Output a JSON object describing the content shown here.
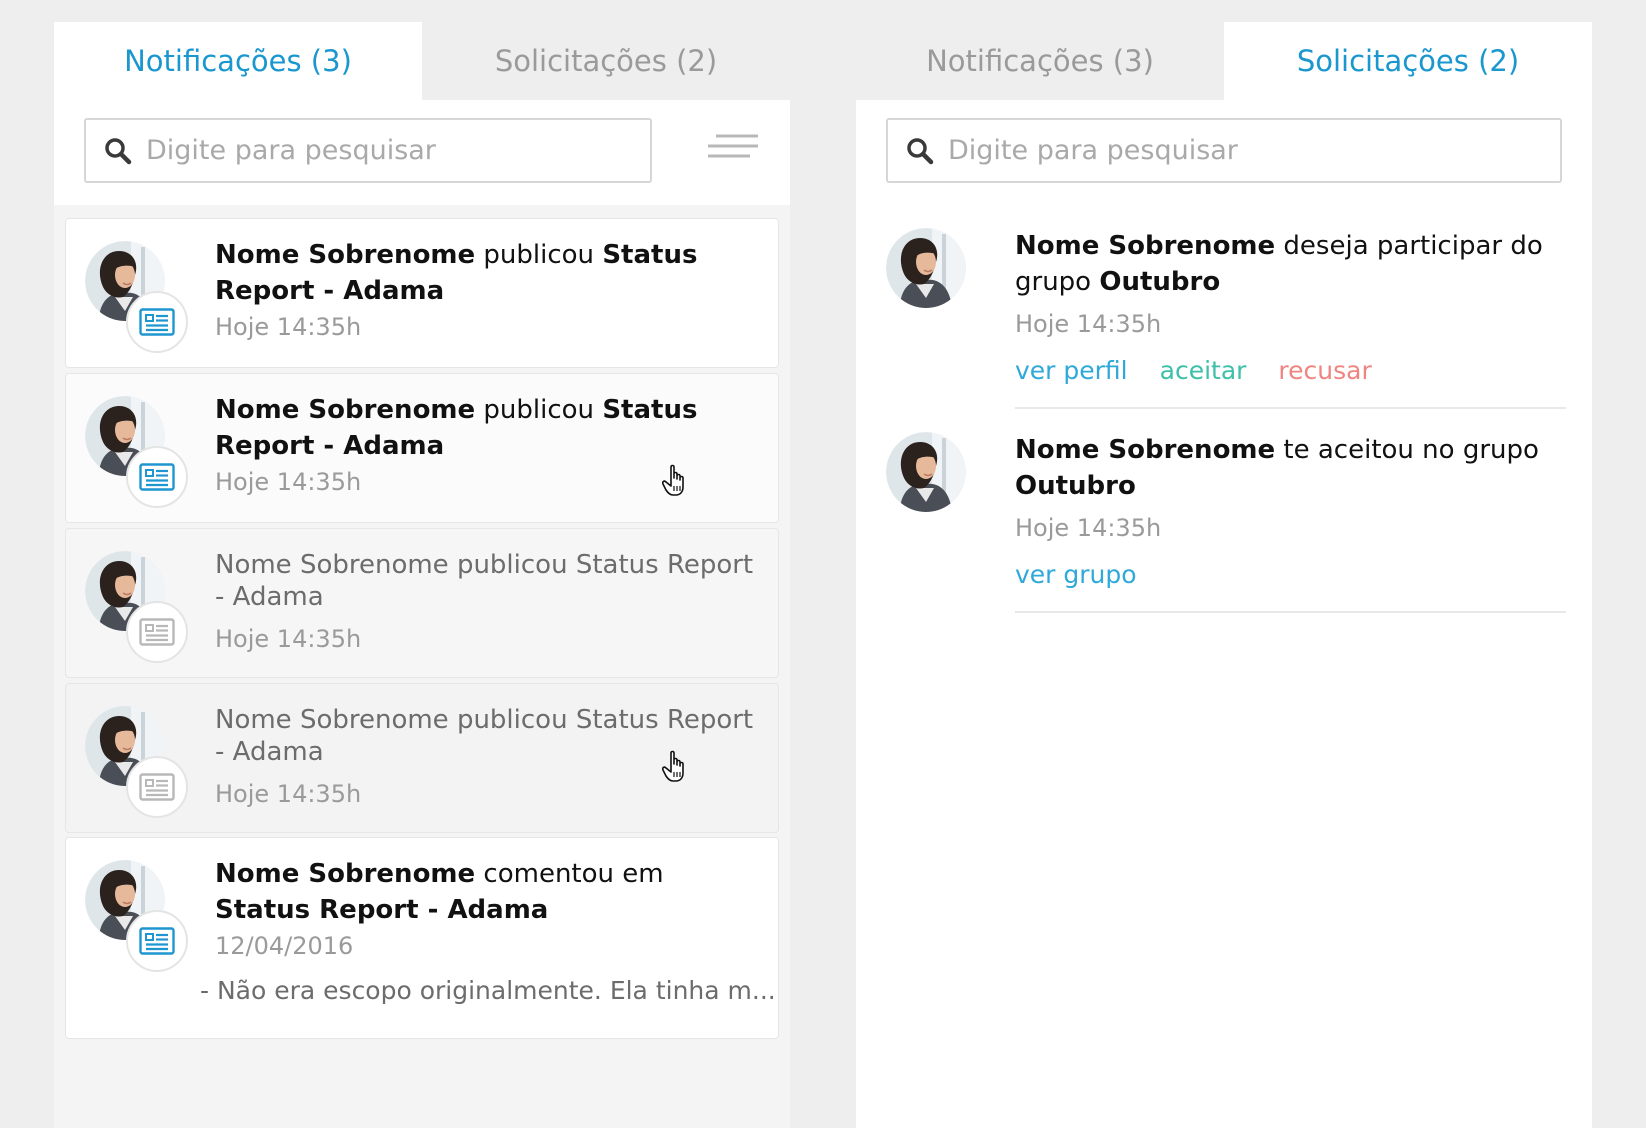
{
  "left_panel": {
    "tabs": [
      {
        "label": "Notificações (3)",
        "active": true
      },
      {
        "label": "Solicitações (2)",
        "active": false
      }
    ],
    "search_placeholder": "Digite para pesquisar",
    "notifications": [
      {
        "name": "Nome Sobrenome",
        "verb": "publicou",
        "object": "Status Report - Adama",
        "time": "Hoje 14:35h",
        "state": "unread"
      },
      {
        "name": "Nome Sobrenome",
        "verb": "publicou",
        "object": "Status Report - Adama",
        "time": "Hoje 14:35h",
        "state": "unread-hover"
      },
      {
        "text": "Nome Sobrenome publicou Status Report - Adama",
        "time": "Hoje 14:35h",
        "state": "read"
      },
      {
        "text": "Nome Sobrenome publicou Status Report - Adama",
        "time": "Hoje 14:35h",
        "state": "read-hover"
      },
      {
        "name": "Nome Sobrenome",
        "verb": "comentou em",
        "object": "Status Report - Adama",
        "time": "12/04/2016",
        "excerpt": "- Não era escopo originalmente. Ela tinha m...",
        "state": "unread"
      }
    ]
  },
  "right_panel": {
    "tabs": [
      {
        "label": "Notificações (3)",
        "active": false
      },
      {
        "label": "Solicitações (2)",
        "active": true
      }
    ],
    "search_placeholder": "Digite para pesquisar",
    "requests": [
      {
        "name": "Nome Sobrenome",
        "text": "deseja participar do grupo",
        "group": "Outubro",
        "time": "Hoje 14:35h",
        "actions": {
          "view": "ver perfil",
          "accept": "aceitar",
          "reject": "recusar"
        }
      },
      {
        "name": "Nome Sobrenome",
        "text": "te aceitou no grupo",
        "group": "Outubro",
        "time": "Hoje 14:35h",
        "actions": {
          "view": "ver grupo"
        }
      }
    ]
  },
  "colors": {
    "accent": "#1a97cf",
    "link": "#2ea9d9",
    "accept": "#3dbfa8",
    "reject": "#ef8580",
    "muted": "#9a9a9a"
  },
  "icons": [
    "search-icon",
    "filter-icon",
    "document-icon",
    "hand-pointer-cursor"
  ]
}
